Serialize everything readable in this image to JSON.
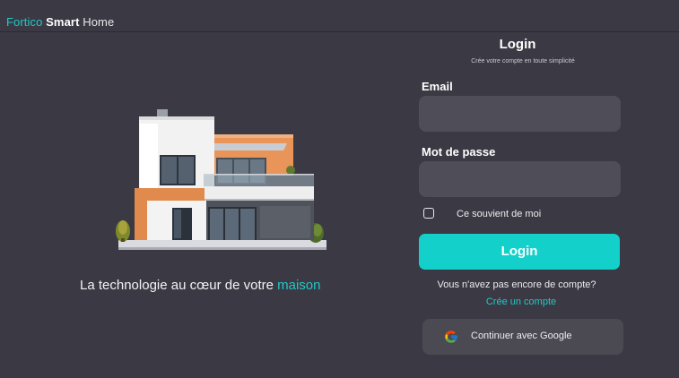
{
  "header": {
    "brand_part1": "Fortico",
    "brand_part2": "Smart",
    "brand_part3": "Home"
  },
  "hero": {
    "tagline_prefix": "La technologie au cœur de votre",
    "tagline_accent": "maison"
  },
  "login": {
    "title": "Login",
    "subtitle": "Crée votre compte en toute simplicité",
    "email_label": "Email",
    "email_value": "",
    "password_label": "Mot de passe",
    "password_value": "",
    "remember_label": "Ce souvient de moi",
    "remember_checked": false,
    "submit_label": "Login",
    "no_account_text": "Vous n'avez pas encore de compte?",
    "create_account_link": "Crée un compte",
    "google_label": "Continuer avec Google"
  },
  "colors": {
    "background": "#3b3a44",
    "accent": "#13d1ca",
    "input_bg": "#4f4e58"
  }
}
